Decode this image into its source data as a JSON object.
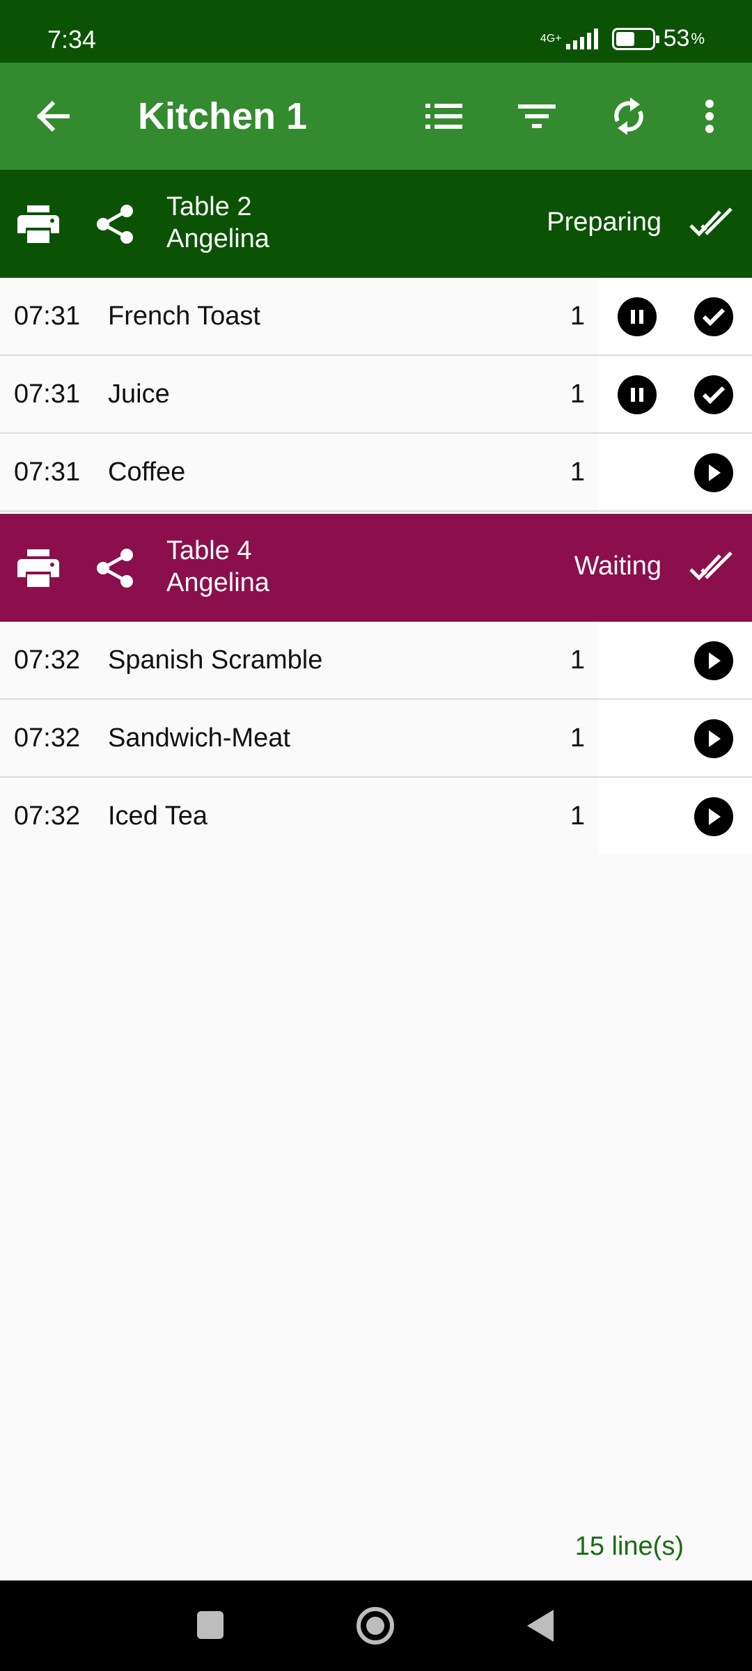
{
  "status_bar": {
    "time": "7:34",
    "network": "4G+",
    "battery_percent": "53",
    "battery_sign": "%",
    "battery_level": 0.53
  },
  "app_bar": {
    "title": "Kitchen 1",
    "icons": [
      "arrow-back-icon",
      "list-icon",
      "filter-icon",
      "sync-icon",
      "more-vert-icon"
    ]
  },
  "colors": {
    "status_bar": "#0b5205",
    "app_bar": "#338a2f",
    "preparing": "#0b5205",
    "waiting": "#8b0f4d",
    "count_text": "#1a6a14"
  },
  "groups": [
    {
      "table": "Table 2",
      "waiter": "Angelina",
      "status": "Preparing",
      "items": [
        {
          "time": "07:31",
          "name": "French Toast",
          "qty": "1",
          "actions": [
            "pause",
            "done"
          ]
        },
        {
          "time": "07:31",
          "name": "Juice",
          "qty": "1",
          "actions": [
            "pause",
            "done"
          ]
        },
        {
          "time": "07:31",
          "name": "Coffee",
          "qty": "1",
          "actions": [
            "start"
          ]
        }
      ]
    },
    {
      "table": "Table 4",
      "waiter": "Angelina",
      "status": "Waiting",
      "items": [
        {
          "time": "07:32",
          "name": "Spanish Scramble",
          "qty": "1",
          "actions": [
            "start"
          ]
        },
        {
          "time": "07:32",
          "name": "Sandwich-Meat",
          "qty": "1",
          "actions": [
            "start"
          ]
        },
        {
          "time": "07:32",
          "name": "Iced Tea",
          "qty": "1",
          "actions": [
            "start"
          ]
        }
      ]
    }
  ],
  "footer": {
    "line_count": "15 line(s)"
  }
}
